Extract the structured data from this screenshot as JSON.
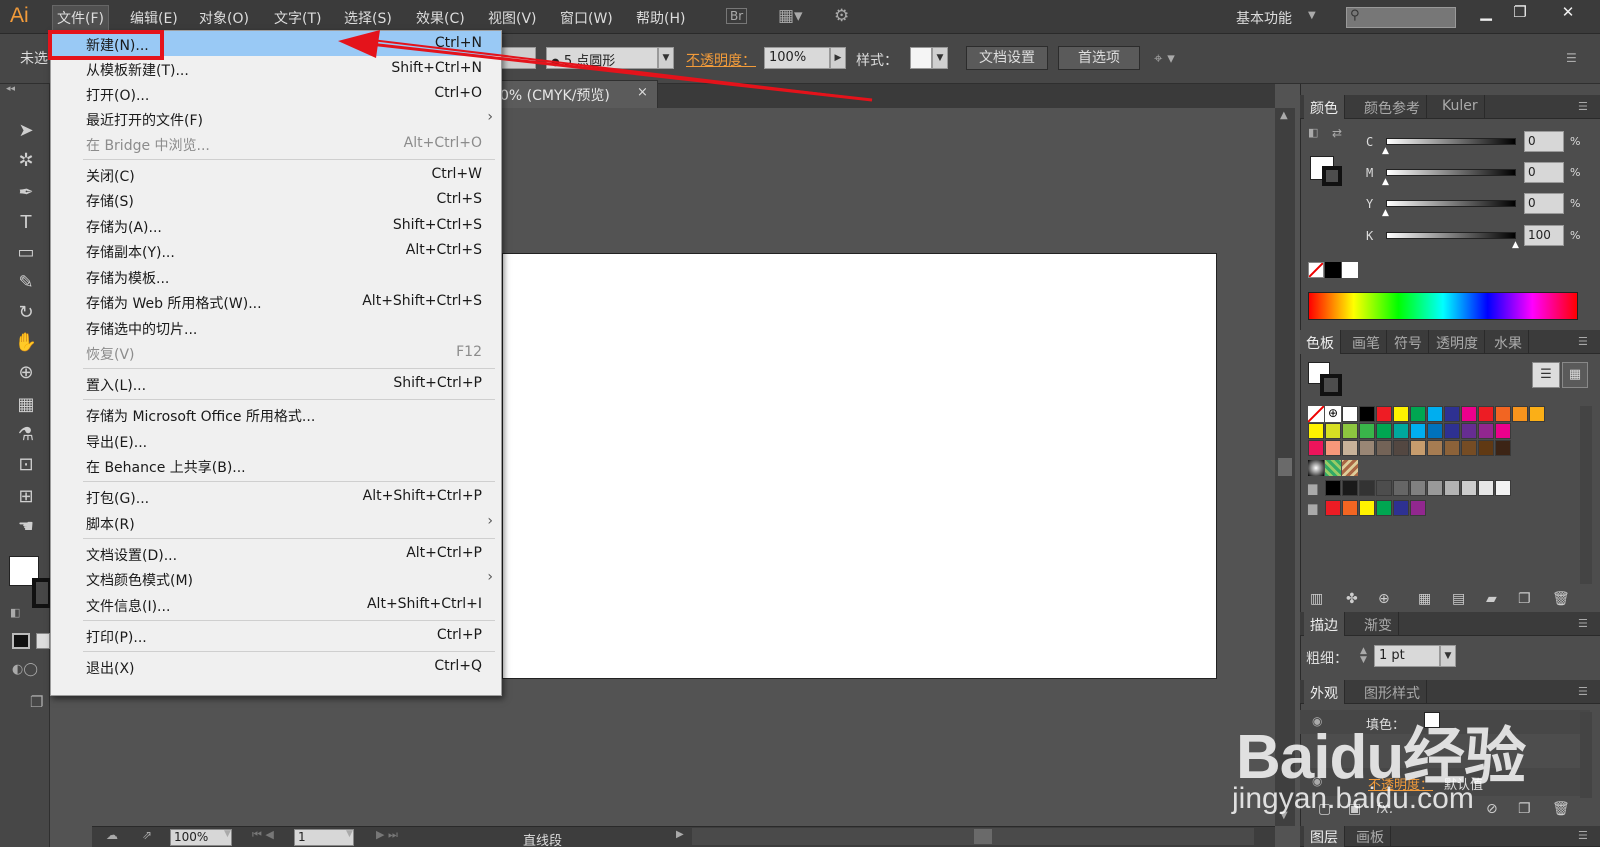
{
  "app": {
    "logo": "Ai",
    "menus": [
      "文件(F)",
      "编辑(E)",
      "对象(O)",
      "文字(T)",
      "选择(S)",
      "效果(C)",
      "视图(V)",
      "窗口(W)",
      "帮助(H)"
    ],
    "bridge_button": "Br",
    "workspace": "基本功能"
  },
  "control_bar": {
    "selection_label": "未选",
    "stroke_profile": "5 点圆形",
    "opacity_label": "不透明度：",
    "opacity_value": "100%",
    "style_label": "样式：",
    "doc_setup_button": "文档设置",
    "preferences_button": "首选项"
  },
  "document": {
    "tab_title": "0% (CMYK/预览)",
    "tab_close": "×"
  },
  "file_menu": {
    "items": [
      {
        "label": "新建(N)...",
        "shortcut": "Ctrl+N",
        "highlighted": true
      },
      {
        "label": "从模板新建(T)...",
        "shortcut": "Shift+Ctrl+N"
      },
      {
        "label": "打开(O)...",
        "shortcut": "Ctrl+O"
      },
      {
        "label": "最近打开的文件(F)",
        "shortcut": "",
        "submenu": true
      },
      {
        "label": "在 Bridge 中浏览...",
        "shortcut": "Alt+Ctrl+O",
        "disabled": true
      },
      {
        "label": "关闭(C)",
        "shortcut": "Ctrl+W"
      },
      {
        "label": "存储(S)",
        "shortcut": "Ctrl+S"
      },
      {
        "label": "存储为(A)...",
        "shortcut": "Shift+Ctrl+S"
      },
      {
        "label": "存储副本(Y)...",
        "shortcut": "Alt+Ctrl+S"
      },
      {
        "label": "存储为模板...",
        "shortcut": ""
      },
      {
        "label": "存储为 Web 所用格式(W)...",
        "shortcut": "Alt+Shift+Ctrl+S"
      },
      {
        "label": "存储选中的切片...",
        "shortcut": ""
      },
      {
        "label": "恢复(V)",
        "shortcut": "F12",
        "disabled": true
      },
      {
        "label": "置入(L)...",
        "shortcut": "Shift+Ctrl+P"
      },
      {
        "label": "存储为 Microsoft Office 所用格式...",
        "shortcut": ""
      },
      {
        "label": "导出(E)...",
        "shortcut": ""
      },
      {
        "label": "在 Behance 上共享(B)...",
        "shortcut": ""
      },
      {
        "label": "打包(G)...",
        "shortcut": "Alt+Shift+Ctrl+P"
      },
      {
        "label": "脚本(R)",
        "shortcut": "",
        "submenu": true
      },
      {
        "label": "文档设置(D)...",
        "shortcut": "Alt+Ctrl+P"
      },
      {
        "label": "文档颜色模式(M)",
        "shortcut": "",
        "submenu": true
      },
      {
        "label": "文件信息(I)...",
        "shortcut": "Alt+Shift+Ctrl+I"
      },
      {
        "label": "打印(P)...",
        "shortcut": "Ctrl+P"
      },
      {
        "label": "退出(X)",
        "shortcut": "Ctrl+Q"
      }
    ]
  },
  "color_panel": {
    "tabs": [
      "颜色",
      "颜色参考",
      "Kuler"
    ],
    "channels": [
      {
        "name": "C",
        "value": "0",
        "level": 0
      },
      {
        "name": "M",
        "value": "0",
        "level": 0
      },
      {
        "name": "Y",
        "value": "0",
        "level": 0
      },
      {
        "name": "K",
        "value": "100",
        "level": 1
      }
    ],
    "percent_sign": "%"
  },
  "swatches_panel": {
    "tabs": [
      "色板",
      "画笔",
      "符号",
      "透明度",
      "水果"
    ],
    "row1": [
      "#ffffff",
      "#000000",
      "#ee1c24",
      "#fff200",
      "#00a651",
      "#00aeef",
      "#2e3192",
      "#ec008c",
      "#ed1c24",
      "#f26522",
      "#f7941d",
      "#fbaf17"
    ],
    "row2": [
      "#fff200",
      "#d7df23",
      "#8dc63f",
      "#39b54a",
      "#00a651",
      "#00a99d",
      "#00aeef",
      "#0072bc",
      "#2e3192",
      "#662d91",
      "#92278f",
      "#ec008c"
    ],
    "row3": [
      "#ed145b",
      "#f7977a",
      "#c7b299",
      "#998675",
      "#736357",
      "#534741",
      "#c69c6d",
      "#a67c52",
      "#8c6239",
      "#754c24",
      "#603913",
      "#3c2415"
    ],
    "grays": [
      "#000000",
      "#1a1a1a",
      "#333333",
      "#4d4d4d",
      "#666666",
      "#808080",
      "#999999",
      "#b3b3b3",
      "#cccccc",
      "#e6e6e6",
      "#f2f2f2"
    ],
    "brights": [
      "#ed1c24",
      "#f26522",
      "#fff200",
      "#00a651",
      "#2e3192",
      "#92278f"
    ]
  },
  "stroke_panel": {
    "tabs": [
      "描边",
      "渐变"
    ],
    "weight_label": "粗细：",
    "weight_value": "1 pt"
  },
  "appearance_panel": {
    "tabs": [
      "外观",
      "图形样式"
    ],
    "fill_label": "填色：",
    "opacity_label": "不透明度：",
    "opacity_value": "默认值"
  },
  "layers_panel": {
    "tabs": [
      "图层",
      "画板"
    ]
  },
  "status_bar": {
    "zoom": "100%",
    "artboard": "1",
    "status": "直线段"
  },
  "watermark": {
    "brand": "Baidu经验",
    "url": "jingyan.baidu.com"
  }
}
